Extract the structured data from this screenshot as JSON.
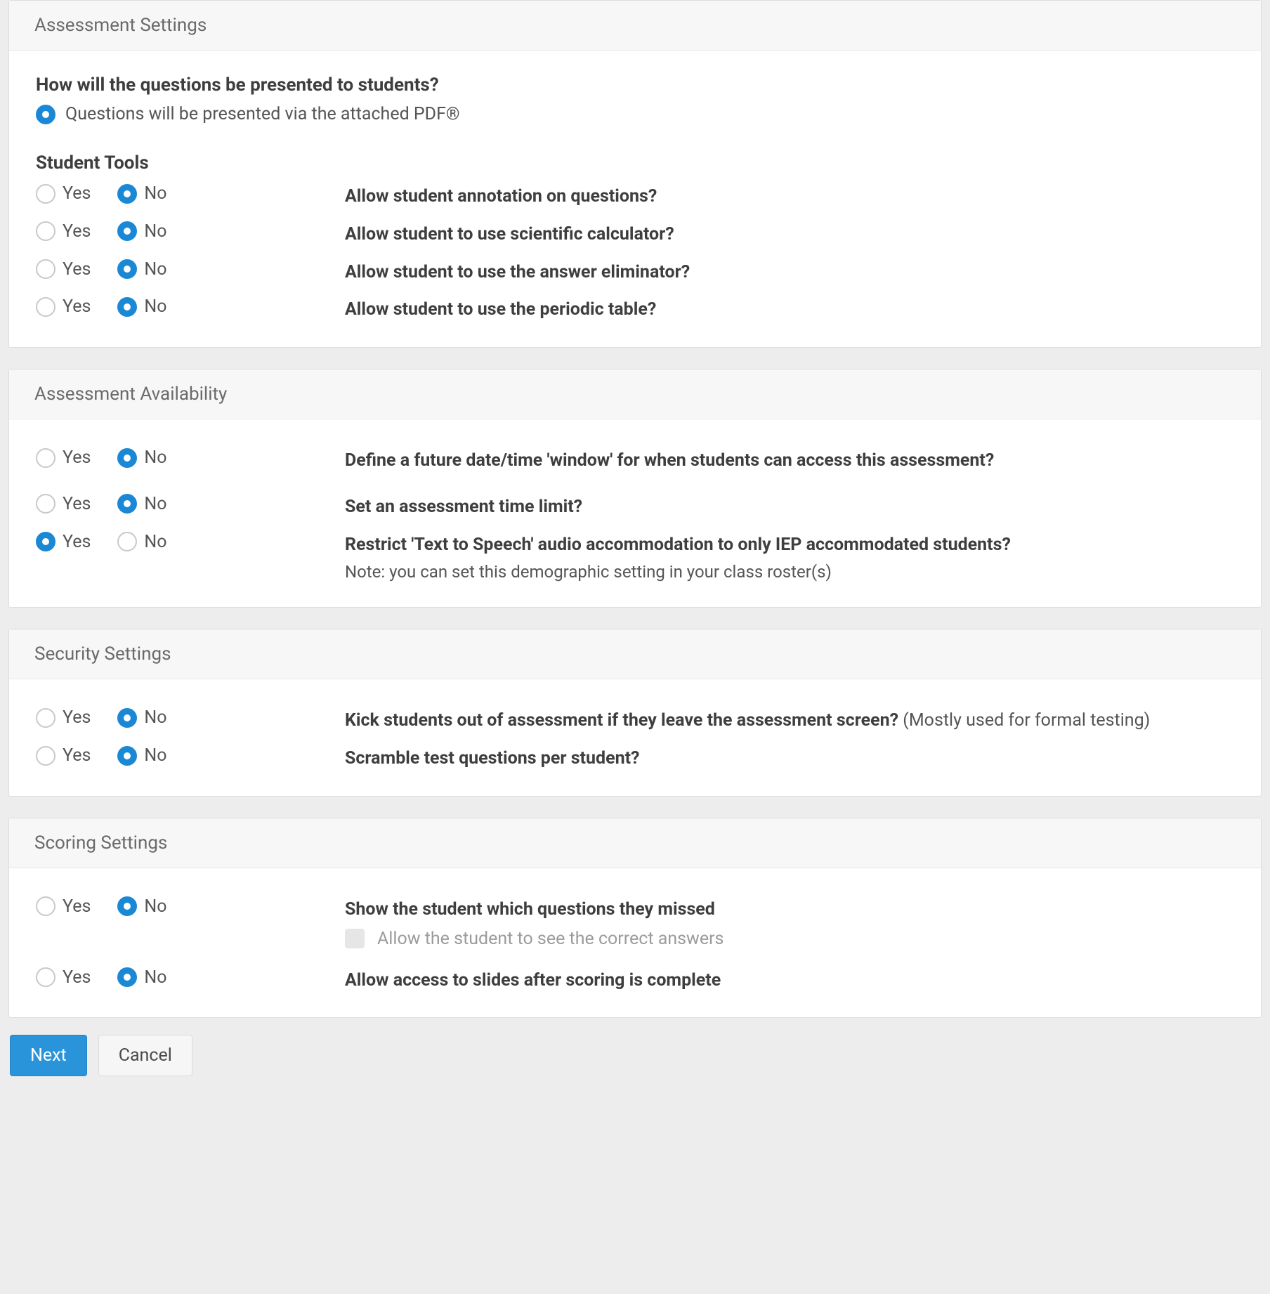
{
  "labels": {
    "yes": "Yes",
    "no": "No"
  },
  "assessment_settings": {
    "title": "Assessment Settings",
    "presentation_question": "How will the questions be presented to students?",
    "presentation_option": "Questions will be presented via the attached PDF®",
    "student_tools_title": "Student Tools",
    "tools": [
      {
        "label": "Allow student annotation on questions?",
        "value": "no"
      },
      {
        "label": "Allow student to use scientific calculator?",
        "value": "no"
      },
      {
        "label": "Allow student to use the answer eliminator?",
        "value": "no"
      },
      {
        "label": "Allow student to use the periodic table?",
        "value": "no"
      }
    ]
  },
  "availability": {
    "title": "Assessment Availability",
    "items": [
      {
        "label": "Define a future date/time 'window' for when students can access this assessment?",
        "value": "no"
      },
      {
        "label": "Set an assessment time limit?",
        "value": "no"
      },
      {
        "label": "Restrict 'Text to Speech' audio accommodation to only IEP accommodated students?",
        "note": "Note: you can set this demographic setting in your class roster(s)",
        "value": "yes"
      }
    ]
  },
  "security": {
    "title": "Security Settings",
    "items": [
      {
        "label": "Kick students out of assessment if they leave the assessment screen?",
        "hint": "(Mostly used for formal testing)",
        "value": "no"
      },
      {
        "label": "Scramble test questions per student?",
        "value": "no"
      }
    ]
  },
  "scoring": {
    "title": "Scoring Settings",
    "show_missed": {
      "label": "Show the student which questions they missed",
      "value": "no"
    },
    "allow_correct_answers": {
      "label": "Allow the student to see the correct answers",
      "checked": false,
      "disabled": true
    },
    "allow_slides": {
      "label": "Allow access to slides after scoring is complete",
      "value": "no"
    }
  },
  "footer": {
    "next": "Next",
    "cancel": "Cancel"
  }
}
